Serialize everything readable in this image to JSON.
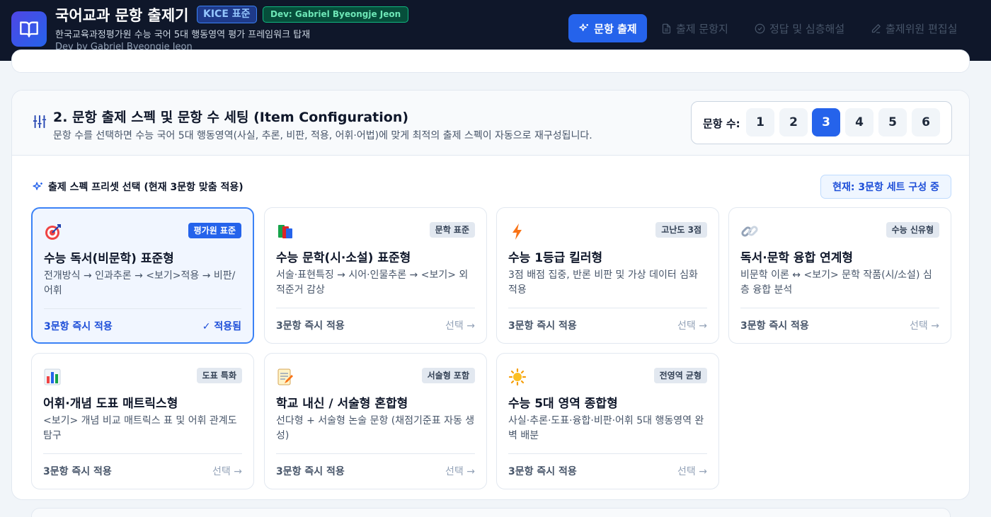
{
  "header": {
    "title": "국어교과 문항 출제기",
    "badge_kice": "KICE 표준",
    "badge_dev": "Dev: Gabriel Byeongje Jeon",
    "subtitle": "한국교육과정평가원 수능 국어 5대 행동영역 평가 프레임워크 탑재",
    "dev_line": "Dev by Gabriel Byeongje Jeon",
    "logo_icon": "book-open-icon"
  },
  "nav": {
    "primary": "문항 출제",
    "items": [
      "출제 문항지",
      "정답 및 심층해설",
      "출제위원 편집실"
    ]
  },
  "section": {
    "title": "2. 문항 출제 스펙 및 문항 수 세팅 (Item Configuration)",
    "description": "문항 수를 선택하면 수능 국어 5대 행동영역(사실, 추론, 비판, 적용, 어휘·어법)에 맞게 최적의 출제 스펙이 자동으로 재구성됩니다.",
    "count_label": "문항 수:",
    "counts": [
      "1",
      "2",
      "3",
      "4",
      "5",
      "6"
    ],
    "selected_count": "3"
  },
  "presets": {
    "label": "출제 스펙 프리셋 선택 (현재 3문항 맞춤 적용)",
    "current": "현재: 3문항 세트 구성 중",
    "cards": [
      {
        "tag": "평가원 표준",
        "title": "수능 독서(비문학) 표준형",
        "desc": "전개방식 → 인과추론 → <보기>적용 → 비판/어휘",
        "apply": "3문항 즉시 적용",
        "select": "✓ 적용됨",
        "icon": "target-icon"
      },
      {
        "tag": "문학 표준",
        "title": "수능 문학(시·소설) 표준형",
        "desc": "서술·표현특징 → 시어·인물추론 → <보기> 외적준거 감상",
        "apply": "3문항 즉시 적용",
        "select": "선택 →",
        "icon": "books-icon"
      },
      {
        "tag": "고난도 3점",
        "title": "수능 1등급 킬러형",
        "desc": "3점 배점 집중, 반론 비판 및 가상 데이터 심화 적용",
        "apply": "3문항 즉시 적용",
        "select": "선택 →",
        "icon": "lightning-icon"
      },
      {
        "tag": "수능 신유형",
        "title": "독서·문학 융합 연계형",
        "desc": "비문학 이론 ↔ <보기> 문학 작품(시/소설) 심층 융합 분석",
        "apply": "3문항 즉시 적용",
        "select": "선택 →",
        "icon": "link-icon"
      },
      {
        "tag": "도표 특화",
        "title": "어휘·개념 도표 매트릭스형",
        "desc": "<보기> 개념 비교 매트릭스 표 및 어휘 관계도 탐구",
        "apply": "3문항 즉시 적용",
        "select": "선택 →",
        "icon": "bar-chart-icon"
      },
      {
        "tag": "서술형 포함",
        "title": "학교 내신 / 서술형 혼합형",
        "desc": "선다형 + 서술형 논술 문항 (채점기준표 자동 생성)",
        "apply": "3문항 즉시 적용",
        "select": "선택 →",
        "icon": "memo-icon"
      },
      {
        "tag": "전영역 균형",
        "title": "수능 5대 영역 종합형",
        "desc": "사실·추론·도표·융합·비판·어휘 5대 행동영역 완벽 배분",
        "apply": "3문항 즉시 적용",
        "select": "선택 →",
        "icon": "sun-icon"
      }
    ]
  },
  "colors": {
    "accent": "#2563eb",
    "header_bg": "#0f172a"
  }
}
